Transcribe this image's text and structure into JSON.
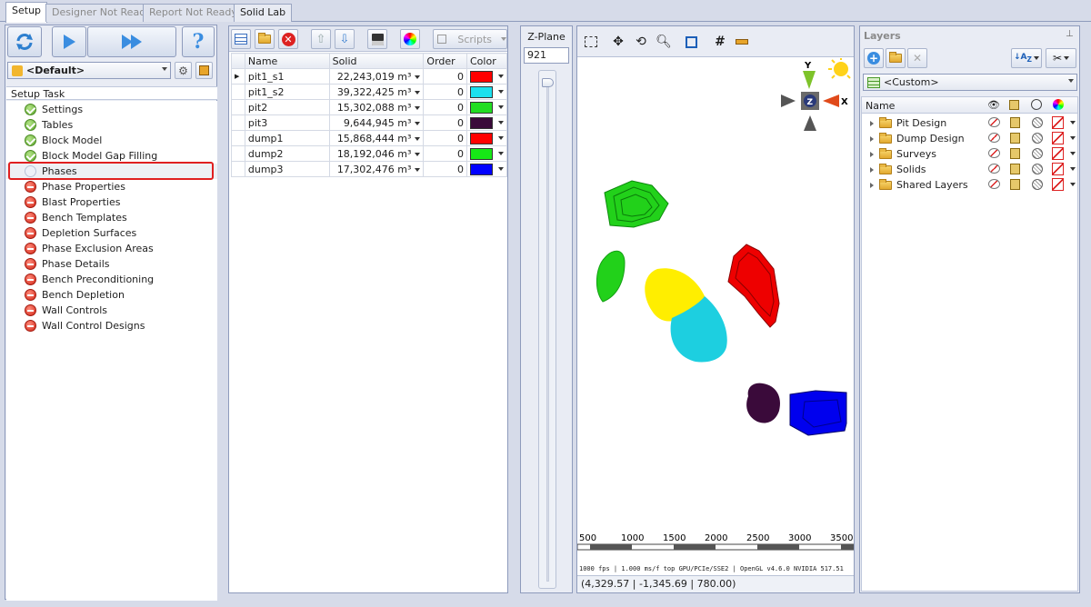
{
  "tabs": [
    "Setup",
    "Designer Not Ready",
    "Report Not Ready",
    "Solid Lab"
  ],
  "left": {
    "scenario": "<Default>",
    "header": "Setup Task",
    "tasks": [
      {
        "label": "Settings",
        "status": "ok"
      },
      {
        "label": "Tables",
        "status": "ok"
      },
      {
        "label": "Block Model",
        "status": "ok"
      },
      {
        "label": "Block Model Gap Filling",
        "status": "ok"
      },
      {
        "label": "Phases",
        "status": "empty"
      },
      {
        "label": "Phase Properties",
        "status": "no"
      },
      {
        "label": "Blast Properties",
        "status": "no"
      },
      {
        "label": "Bench Templates",
        "status": "no"
      },
      {
        "label": "Depletion Surfaces",
        "status": "no"
      },
      {
        "label": "Phase Exclusion Areas",
        "status": "no"
      },
      {
        "label": "Phase Details",
        "status": "no"
      },
      {
        "label": "Bench Preconditioning",
        "status": "no"
      },
      {
        "label": "Bench Depletion",
        "status": "no"
      },
      {
        "label": "Wall Controls",
        "status": "no"
      },
      {
        "label": "Wall Control Designs",
        "status": "no"
      }
    ]
  },
  "table": {
    "scripts_label": "Scripts",
    "columns": [
      "Name",
      "Solid",
      "Order",
      "Color"
    ],
    "rows": [
      {
        "name": "pit1_s1",
        "solid": "22,243,019 m³",
        "order": "0",
        "color": "#ff0000"
      },
      {
        "name": "pit1_s2",
        "solid": "39,322,425 m³",
        "order": "0",
        "color": "#1ce0ee"
      },
      {
        "name": "pit2",
        "solid": "15,302,088 m³",
        "order": "0",
        "color": "#22dd22"
      },
      {
        "name": "pit3",
        "solid": "9,644,945 m³",
        "order": "0",
        "color": "#3a0a3a"
      },
      {
        "name": "dump1",
        "solid": "15,868,444 m³",
        "order": "0",
        "color": "#ff0000"
      },
      {
        "name": "dump2",
        "solid": "18,192,046 m³",
        "order": "0",
        "color": "#16e816"
      },
      {
        "name": "dump3",
        "solid": "17,302,476 m³",
        "order": "0",
        "color": "#0000ff"
      }
    ]
  },
  "zplane": {
    "label": "Z-Plane",
    "value": "921"
  },
  "viewport": {
    "axis": {
      "y": "Y",
      "x": "X",
      "z": "Z"
    },
    "scale_labels": [
      "500",
      "1000",
      "1500",
      "2000",
      "2500",
      "3000",
      "3500"
    ],
    "status_line": "1000 fps | 1.000 ms/f top GPU/PCIe/SSE2 | OpenGL v4.6.0 NVIDIA 517.51",
    "coords": "(4,329.57 | -1,345.69 | 780.00)",
    "colors": {
      "green": "#22d11a",
      "yellow": "#ffee00",
      "cyan": "#1dcfe0",
      "red": "#ee0000",
      "purple": "#3a0a3a",
      "blue": "#0000ee"
    }
  },
  "layers": {
    "title": "Layers",
    "filter": "<Custom>",
    "name_col": "Name",
    "items": [
      "Pit Design",
      "Dump Design",
      "Surveys",
      "Solids",
      "Shared Layers"
    ]
  }
}
